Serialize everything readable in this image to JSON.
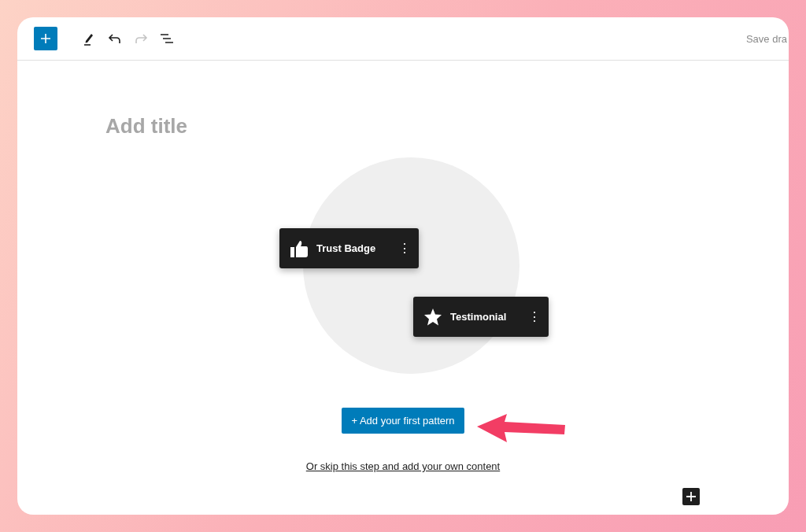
{
  "toolbar": {
    "tools": [
      {
        "kind": "add",
        "disabled": false
      },
      {
        "kind": "pen",
        "disabled": false
      },
      {
        "kind": "undo",
        "disabled": false
      },
      {
        "kind": "redo",
        "disabled": true
      },
      {
        "kind": "outline",
        "disabled": false
      }
    ],
    "save_label": "Save dra"
  },
  "editor": {
    "title_placeholder": "Add title"
  },
  "patterns": [
    {
      "kind": "thumb",
      "label": "Trust Badge",
      "menu": "⋮"
    },
    {
      "kind": "star",
      "label": "Testimonial",
      "menu": "⋮"
    }
  ],
  "primary_button": "+ Add your first pattern",
  "skip_link": "Or skip this step and add your own content"
}
